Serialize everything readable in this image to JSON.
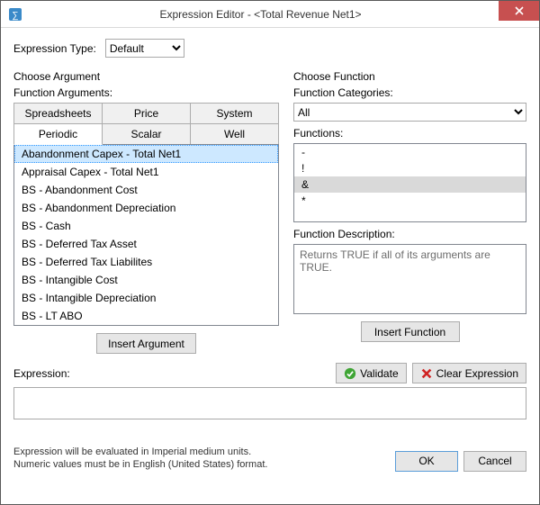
{
  "title": "Expression Editor - <Total Revenue Net1>",
  "expression_type": {
    "label": "Expression Type:",
    "selected": "Default"
  },
  "left": {
    "choose_label": "Choose Argument",
    "args_label": "Function Arguments:",
    "tabs_row1": [
      "Spreadsheets",
      "Price",
      "System"
    ],
    "tabs_row2": [
      "Periodic",
      "Scalar",
      "Well"
    ],
    "active_tab": "Periodic",
    "items": [
      "Abandonment Capex - Total Net1",
      "Appraisal Capex - Total Net1",
      "BS - Abandonment Cost",
      "BS - Abandonment Depreciation",
      "BS - Cash",
      "BS - Deferred Tax Asset",
      "BS - Deferred Tax Liabilites",
      "BS - Intangible Cost",
      "BS - Intangible Depreciation",
      "BS - LT ABO"
    ],
    "selected_index": 0,
    "insert_label": "Insert Argument"
  },
  "right": {
    "choose_label": "Choose Function",
    "cat_label": "Function Categories:",
    "cat_selected": "All",
    "fn_label": "Functions:",
    "fn_items": [
      "-",
      "!",
      "&",
      "*"
    ],
    "fn_selected_index": 2,
    "desc_label": "Function Description:",
    "desc_text": "Returns TRUE if all of its arguments are TRUE.",
    "insert_label": "Insert Function"
  },
  "expression": {
    "label": "Expression:",
    "validate_label": "Validate",
    "clear_label": "Clear Expression",
    "value": ""
  },
  "footer": {
    "note1": "Expression will be evaluated in Imperial medium units.",
    "note2": "Numeric values must be in English (United States) format.",
    "ok": "OK",
    "cancel": "Cancel"
  }
}
